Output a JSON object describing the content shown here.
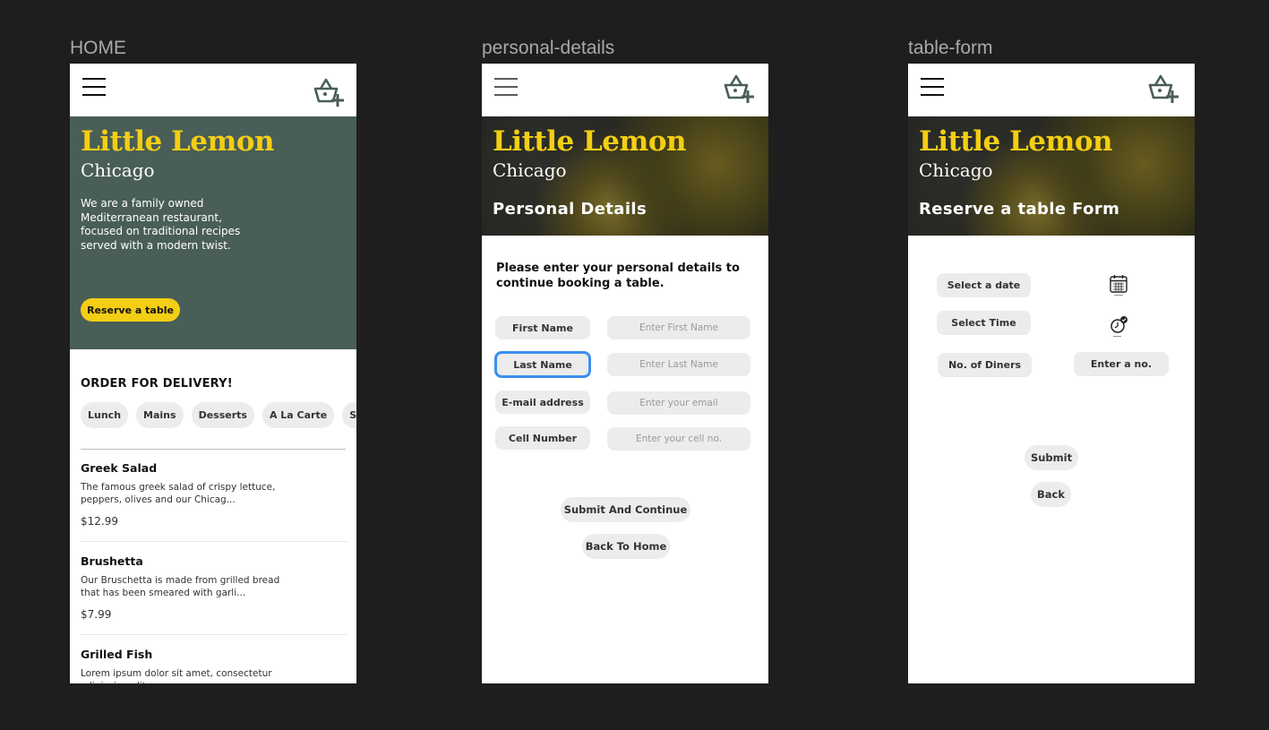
{
  "frames": {
    "home_label": "HOME",
    "personal_label": "personal-details",
    "table_label": "table-form"
  },
  "brand": {
    "title": "Little Lemon",
    "city": "Chicago"
  },
  "home": {
    "description": "We are a family owned Mediterranean restaurant, focused on traditional recipes served with a modern twist.",
    "reserve_label": "Reserve a table",
    "order_title": "ORDER FOR DELIVERY!",
    "categories": [
      "Lunch",
      "Mains",
      "Desserts",
      "A La Carte",
      "Specials"
    ],
    "items": [
      {
        "name": "Greek Salad",
        "description": "The famous greek salad of crispy lettuce, peppers, olives and our Chicag...",
        "price": "$12.99"
      },
      {
        "name": "Brushetta",
        "description": "Our Bruschetta is made from grilled bread that has been smeared with garli...",
        "price": "$7.99"
      },
      {
        "name": "Grilled Fish",
        "description": "Lorem ipsum dolor sit amet, consectetur adipiscing elit",
        "price": ""
      }
    ]
  },
  "personal": {
    "section_title": "Personal Details",
    "instruction": "Please enter your personal details to continue booking a table.",
    "fields": [
      {
        "label": "First Name",
        "placeholder": "Enter First Name"
      },
      {
        "label": "Last Name",
        "placeholder": "Enter Last Name"
      },
      {
        "label": "E-mail address",
        "placeholder": "Enter your email"
      },
      {
        "label": "Cell Number",
        "placeholder": "Enter your cell no."
      }
    ],
    "submit_label": "Submit And Continue",
    "back_label": "Back To Home"
  },
  "table": {
    "section_title": "Reserve a table Form",
    "date_label": "Select a date",
    "time_label": "Select Time",
    "diners_label": "No. of Diners",
    "diners_placeholder": "Enter a no.",
    "submit_label": "Submit",
    "back_label": "Back"
  },
  "icons": {
    "menu": "hamburger-menu-icon",
    "basket": "basket-add-icon",
    "calendar": "calendar-icon",
    "clock": "clock-check-icon"
  },
  "colors": {
    "background": "#1e1e1e",
    "brand_green": "#495e57",
    "brand_yellow": "#f4ce14",
    "focus_blue": "#3b8ff0",
    "pill_gray": "#ececec"
  }
}
